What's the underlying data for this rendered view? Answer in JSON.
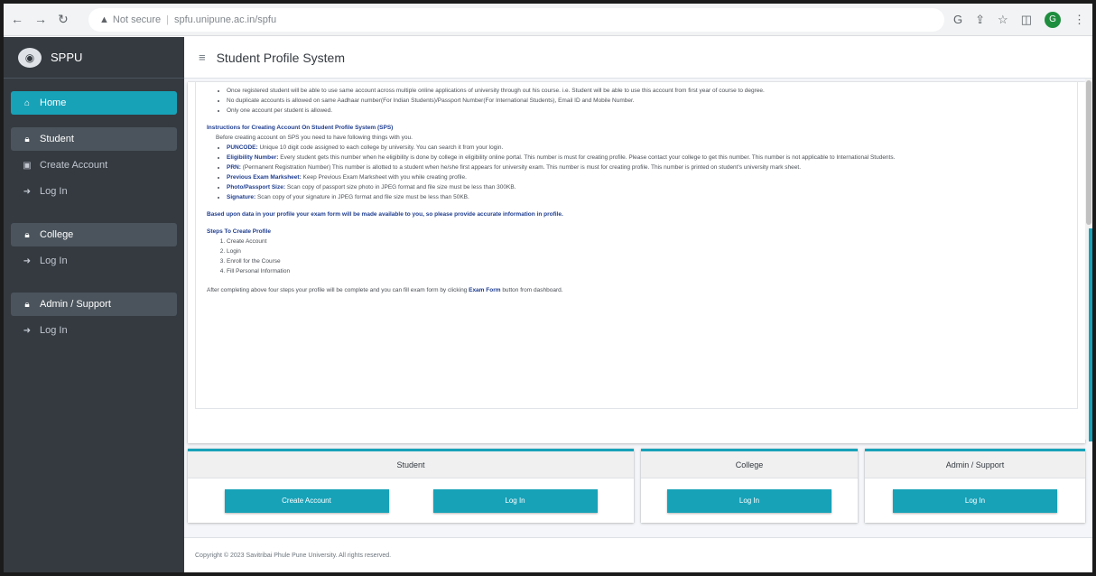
{
  "browser": {
    "warning": "Not secure",
    "url": "spfu.unipune.ac.in/spfu",
    "profile_initial": "G"
  },
  "sidebar": {
    "brand": "SPPU",
    "home": "Home",
    "student_group": "Student",
    "student_create": "Create Account",
    "student_login": "Log In",
    "college_group": "College",
    "college_login": "Log In",
    "admin_group": "Admin / Support",
    "admin_login": "Log In"
  },
  "topbar": {
    "title": "Student Profile System"
  },
  "content": {
    "bullets_top": [
      "Once registered student will be able to use same account across multiple online applications of university through out his course. i.e. Student will be able to use this account from first year of course to degree.",
      "No duplicate accounts is allowed on same Aadhaar number(For Indian Students)/Passport Number(For International Students), Email ID and Mobile Number.",
      "Only one account per student is allowed."
    ],
    "instructions_title": "Instructions for Creating Account On Student Profile System (SPS)",
    "instructions_intro": "Before creating account on SPS you need to have following things with you.",
    "instructions": [
      {
        "label": "PUNCODE:",
        "text": " Unique 10 digit code assigned to each college by university. You can search it from your login."
      },
      {
        "label": "Eligibility Number:",
        "text": " Every student gets this number when he eligibility is done by college in eligibility online portal. This number is must for creating profile. Please contact your college to get this number. This number is not applicable to International Students."
      },
      {
        "label": "PRN:",
        "text": " (Permanent Registration Number) This number is allotted to a student when he/she first appears for university exam. This number is must for creating profile. This number is printed on student's university mark sheet."
      },
      {
        "label": "Previous Exam Marksheet:",
        "text": " Keep Previous Exam Marksheet with you while creating profile."
      },
      {
        "label": "Photo/Passport Size:",
        "text": " Scan copy of passport size photo in JPEG format and file size must be less than 300KB."
      },
      {
        "label": "Signature:",
        "text": " Scan copy of your signature in JPEG format and file size must be less than 50KB."
      }
    ],
    "based_note": "Based upon data in your profile your exam form will be made available to you, so please provide accurate information in profile.",
    "steps_title": "Steps To Create Profile",
    "steps": [
      "Create Account",
      "Login",
      "Enroll for the Course",
      "Fill Personal Information"
    ],
    "after_note_pre": "After completing above four steps your profile will be complete and you can fill exam form by clicking ",
    "after_note_bold": "Exam Form",
    "after_note_post": " button from dashboard."
  },
  "boxes": {
    "student_title": "Student",
    "student_create": "Create Account",
    "student_login": "Log In",
    "college_title": "College",
    "college_login": "Log In",
    "admin_title": "Admin / Support",
    "admin_login": "Log In"
  },
  "footer": {
    "text": "Copyright © 2023 Savitribai Phule Pune University. All rights reserved."
  },
  "colors": {
    "accent": "#17a2b8",
    "sidebar": "#343a40",
    "heading": "#1e3d8f"
  }
}
